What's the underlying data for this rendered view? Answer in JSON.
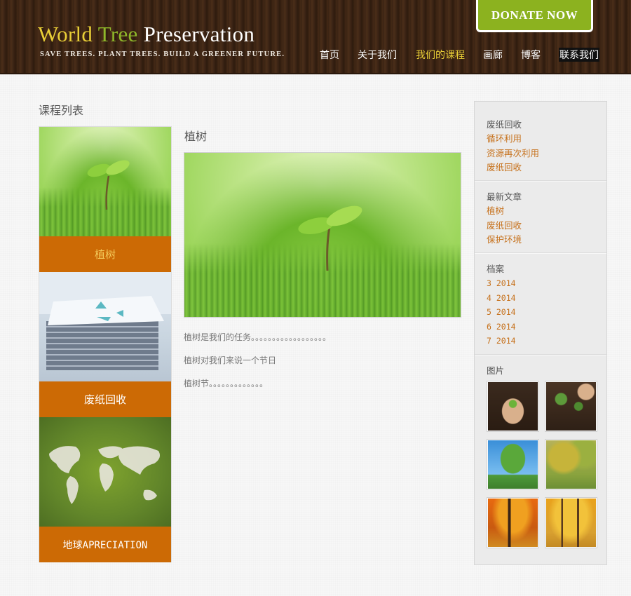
{
  "header": {
    "logo": {
      "word1": "World",
      "word2": "Tree",
      "word3": "Preservation"
    },
    "tagline": "SAVE TREES. PLANT TREES. BUILD A GREENER FUTURE.",
    "donate_label": "DONATE NOW",
    "nav": [
      {
        "label": "首页"
      },
      {
        "label": "关于我们"
      },
      {
        "label": "我们的课程"
      },
      {
        "label": "画廊"
      },
      {
        "label": "博客"
      },
      {
        "label": "联系我们"
      }
    ]
  },
  "left": {
    "title": "课程列表",
    "courses": [
      {
        "label": "植树"
      },
      {
        "label": "废纸回收"
      },
      {
        "label": "地球APRECIATION"
      }
    ]
  },
  "post": {
    "title": "植树",
    "paragraphs": [
      "植树是我们的任务。。。。。。。。。。。。。。。。。。",
      "植树对我们来说一个节日",
      "植树节。。。。。。。。。。。。。"
    ]
  },
  "sidebar": {
    "widgets": [
      {
        "title": "废纸回收",
        "links": [
          "循环利用",
          "资源再次利用",
          "废纸回收"
        ]
      },
      {
        "title": "最新文章",
        "links": [
          "植树",
          "废纸回收",
          "保护环境"
        ]
      },
      {
        "title": "档案",
        "links": [
          "3 2014",
          "4 2014",
          "5 2014",
          "6 2014",
          "7 2014"
        ]
      }
    ],
    "gallery_title": "图片",
    "gallery_thumbs": [
      "hands-seedling",
      "garden-planting",
      "green-tree",
      "autumn-tree",
      "orange-forest",
      "yellow-forest"
    ]
  },
  "colors": {
    "header_bg": "#3d2515",
    "accent_green": "#8cb21f",
    "logo_yellow": "#e9cf37",
    "logo_green": "#8fb82a",
    "course_label_bg": "#cc6a05",
    "link_orange": "#c6701a"
  }
}
